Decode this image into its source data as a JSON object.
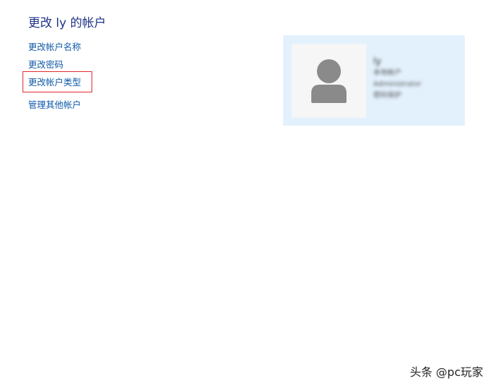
{
  "page": {
    "title": "更改 ly 的帐户"
  },
  "tasks": [
    {
      "label": "更改帐户名称"
    },
    {
      "label": "更改密码"
    },
    {
      "label": "更改帐户类型"
    },
    {
      "label": "管理其他帐户"
    }
  ],
  "account": {
    "name": "ly",
    "type": "本地帐户",
    "group": "Administrator",
    "detail": "密码保护"
  },
  "watermark": "头条 @pc玩家",
  "colors": {
    "title": "#1e3287",
    "link": "#0f5aa8",
    "highlight": "#e0282e",
    "card_bg": "#e3f1fd",
    "avatar_bg": "#f6f6f6",
    "avatar_icon": "#8a8a8a"
  },
  "icons": {
    "avatar": "user-silhouette-icon"
  }
}
